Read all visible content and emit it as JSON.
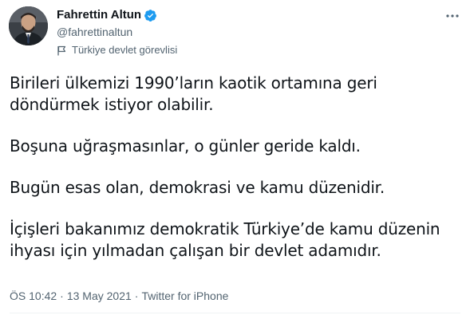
{
  "user": {
    "display_name": "Fahrettin Altun",
    "handle": "@fahrettinaltun",
    "label": "Türkiye devlet görevlisi"
  },
  "tweet": {
    "paragraphs": [
      "Birileri ülkemizi 1990’ların kaotik ortamına geri döndürmek istiyor olabilir.",
      "Boşuna uğraşmasınlar, o günler geride kaldı.",
      "Bugün esas olan, demokrasi ve kamu düzenidir.",
      "İçişleri bakanımız demokratik Türkiye’de kamu düzenin ihyası için yılmadan çalışan bir devlet adamıdır."
    ],
    "time": "ÖS 10:42",
    "separator": "·",
    "date": "13 May 2021",
    "source": "Twitter for iPhone"
  },
  "icons": {
    "verified": "verified-badge-icon",
    "label": "flag-icon",
    "more": "more-options-icon"
  },
  "colors": {
    "text": "#0f1419",
    "secondary": "#536471",
    "verified": "#1d9bf0",
    "background": "#ffffff"
  }
}
